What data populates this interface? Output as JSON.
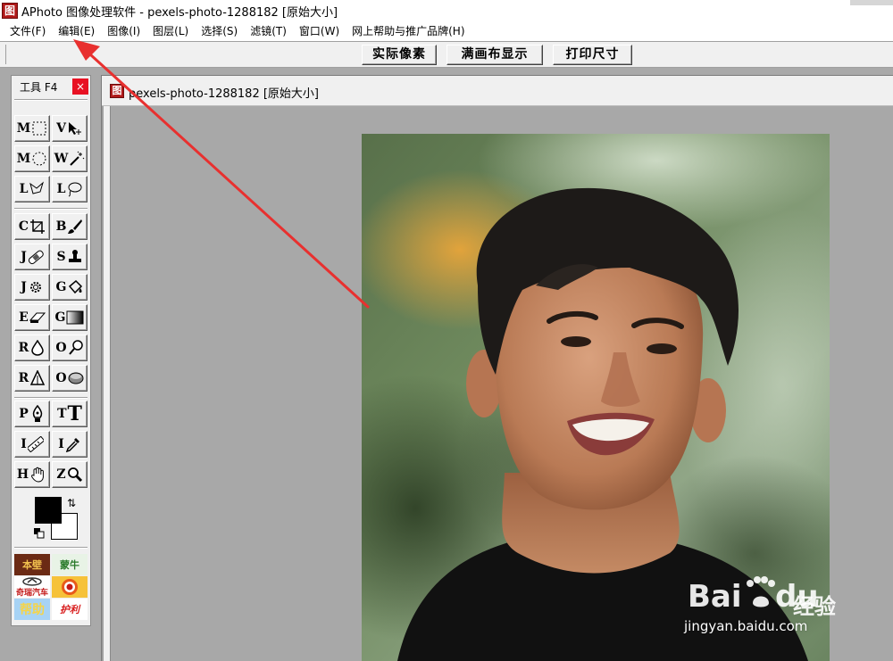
{
  "window": {
    "title": "APhoto 图像处理软件 - pexels-photo-1288182 [原始大小]",
    "logo_glyph": "图"
  },
  "menubar": {
    "items": [
      "文件(F)",
      "编辑(E)",
      "图像(I)",
      "图层(L)",
      "选择(S)",
      "滤镜(T)",
      "窗口(W)",
      "网上帮助与推广品牌(H)"
    ]
  },
  "toolbar": {
    "actual_pixels": "实际像素",
    "fit_canvas": "满画布显示",
    "print_size": "打印尺寸"
  },
  "tool_panel": {
    "title": "工具 F4",
    "close_glyph": "×",
    "tools": [
      {
        "letter": "M",
        "icon": "rect-marquee-icon"
      },
      {
        "letter": "V",
        "icon": "move-icon"
      },
      {
        "letter": "M",
        "icon": "ellipse-marquee-icon"
      },
      {
        "letter": "W",
        "icon": "magic-wand-icon"
      },
      {
        "letter": "L",
        "icon": "polygon-lasso-icon"
      },
      {
        "letter": "L",
        "icon": "lasso-icon"
      },
      {
        "letter": "C",
        "icon": "crop-icon"
      },
      {
        "letter": "B",
        "icon": "brush-icon"
      },
      {
        "letter": "J",
        "icon": "bandage-icon"
      },
      {
        "letter": "S",
        "icon": "stamp-icon"
      },
      {
        "letter": "J",
        "icon": "sun-icon"
      },
      {
        "letter": "G",
        "icon": "bucket-icon"
      },
      {
        "letter": "E",
        "icon": "eraser-icon"
      },
      {
        "letter": "G",
        "icon": "gradient-icon"
      },
      {
        "letter": "R",
        "icon": "drop-icon"
      },
      {
        "letter": "O",
        "icon": "dodge-icon"
      },
      {
        "letter": "R",
        "icon": "sharpen-icon"
      },
      {
        "letter": "O",
        "icon": "sponge-icon"
      },
      {
        "letter": "P",
        "icon": "pen-icon"
      },
      {
        "letter": "T",
        "icon": "text-icon"
      },
      {
        "letter": "I",
        "icon": "measure-icon"
      },
      {
        "letter": "I",
        "icon": "eyedropper-icon"
      },
      {
        "letter": "H",
        "icon": "hand-icon"
      },
      {
        "letter": "Z",
        "icon": "zoom-icon"
      }
    ],
    "text_tool_glyph": "T",
    "swap_glyph": "⇅"
  },
  "brand_tiles": [
    {
      "label": "本壁",
      "bg": "#6b2a14",
      "fg": "#f2c14e"
    },
    {
      "label": "蒙牛",
      "bg": "#e8f3e6",
      "fg": "#2a7a2a"
    },
    {
      "label": "奇瑞汽车",
      "bg": "#ffffff",
      "fg": "#c41a1a"
    },
    {
      "label": "",
      "bg": "#f6c23a",
      "fg": "#c41a1a"
    },
    {
      "label": "帮助",
      "bg": "#a7d3f5",
      "fg": "#f5d44a"
    },
    {
      "label": "护利",
      "bg": "#ffffff",
      "fg": "#d81b1b"
    }
  ],
  "document": {
    "title": "pexels-photo-1288182 [原始大小]",
    "logo_glyph": "图"
  },
  "watermark": {
    "brand": "Bai",
    "brand2": "du",
    "cn": "经验",
    "url": "jingyan.baidu.com"
  },
  "colors": {
    "foreground": "#000000",
    "background": "#ffffff",
    "annotation_red": "#e8302f"
  }
}
